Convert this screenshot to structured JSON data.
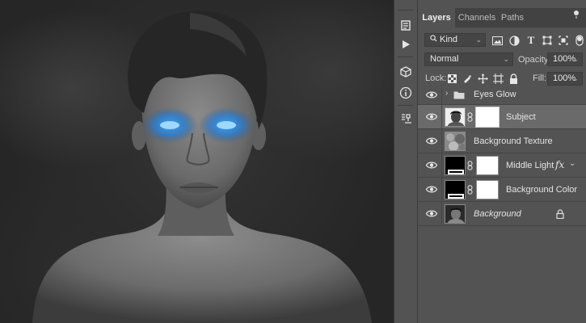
{
  "panel": {
    "tabs": [
      {
        "label": "Layers",
        "active": true
      },
      {
        "label": "Channels",
        "active": false
      },
      {
        "label": "Paths",
        "active": false
      }
    ],
    "filter": {
      "kind_label": "Kind"
    },
    "blend_mode": "Normal",
    "opacity": {
      "label": "Opacity:",
      "value": "100%"
    },
    "lock": {
      "label": "Lock:"
    },
    "fill": {
      "label": "Fill:",
      "value": "100%"
    },
    "layers": [
      {
        "name": "Eyes Glow",
        "type": "group",
        "visible": true,
        "selected": false
      },
      {
        "name": "Subject",
        "type": "masked-pixel",
        "visible": true,
        "selected": true
      },
      {
        "name": "Background Texture",
        "type": "pixel",
        "visible": true,
        "selected": false
      },
      {
        "name": "Middle Light",
        "type": "fill-masked",
        "visible": true,
        "selected": false,
        "fx": "fx"
      },
      {
        "name": "Background Color",
        "type": "fill-masked",
        "visible": true,
        "selected": false
      },
      {
        "name": "Background",
        "type": "background",
        "visible": true,
        "selected": false,
        "locked": true
      }
    ]
  },
  "toolstrip": {
    "icons": [
      "history-icon",
      "play-actions-icon",
      "3d-icon",
      "info-icon",
      "clone-source-icon"
    ]
  },
  "colors": {
    "panel_bg": "#535353",
    "tab_bar_bg": "#424242",
    "selected_layer_bg": "#6a6a6a",
    "eye_glow": "#1f8fff"
  }
}
